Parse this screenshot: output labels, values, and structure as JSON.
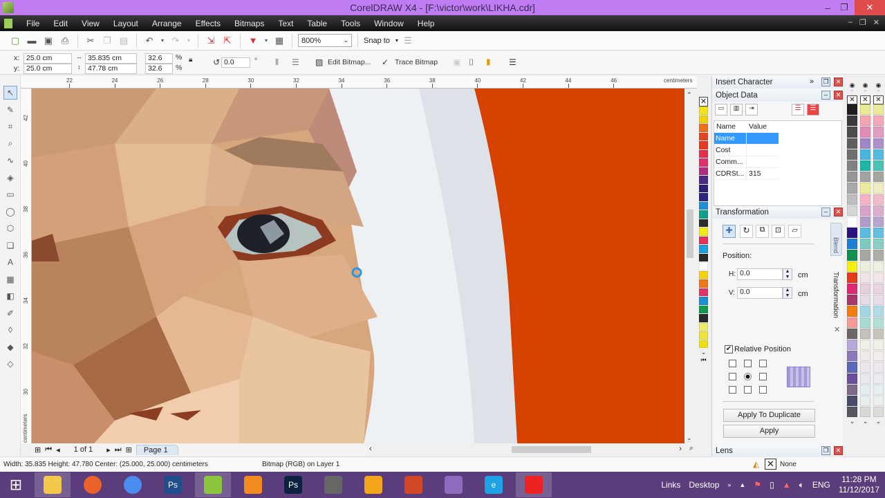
{
  "window": {
    "title": "CorelDRAW X4 - [F:\\victor\\work\\LIKHA.cdr]",
    "minimize": "–",
    "restore": "❐",
    "close": "✕"
  },
  "menu": {
    "items": [
      "File",
      "Edit",
      "View",
      "Layout",
      "Arrange",
      "Effects",
      "Bitmaps",
      "Text",
      "Table",
      "Tools",
      "Window",
      "Help"
    ],
    "mdi_controls": [
      "–",
      "❐",
      "✕"
    ]
  },
  "toolbar": {
    "zoom_level": "800%",
    "snap_to": "Snap to"
  },
  "property_bar": {
    "x_label": "x:",
    "x_value": "25.0 cm",
    "y_label": "y:",
    "y_value": "25.0 cm",
    "width_value": "35.835 cm",
    "height_value": "47.78 cm",
    "scale_x": "32.6",
    "scale_y": "32.6",
    "percent": "%",
    "rotation": "0.0",
    "degree": "°",
    "edit_bitmap": "Edit Bitmap...",
    "trace_bitmap": "Trace Bitmap"
  },
  "ruler": {
    "h_ticks": [
      "22",
      "24",
      "26",
      "28",
      "30",
      "32",
      "34",
      "36",
      "38",
      "40",
      "42",
      "44",
      "46"
    ],
    "h_unit": "centimeters",
    "v_ticks": [
      "42",
      "40",
      "38",
      "36",
      "34",
      "32",
      "30"
    ],
    "v_unit": "centimeters"
  },
  "tools": [
    {
      "name": "pick-tool",
      "glyph": "↖"
    },
    {
      "name": "shape-tool",
      "glyph": "✎"
    },
    {
      "name": "crop-tool",
      "glyph": "⌗"
    },
    {
      "name": "zoom-tool",
      "glyph": "⌕"
    },
    {
      "name": "freehand-tool",
      "glyph": "∿"
    },
    {
      "name": "smart-fill-tool",
      "glyph": "◈"
    },
    {
      "name": "rectangle-tool",
      "glyph": "▭"
    },
    {
      "name": "ellipse-tool",
      "glyph": "◯"
    },
    {
      "name": "polygon-tool",
      "glyph": "⬡"
    },
    {
      "name": "basic-shapes-tool",
      "glyph": "❏"
    },
    {
      "name": "text-tool",
      "glyph": "A"
    },
    {
      "name": "table-tool",
      "glyph": "▦"
    },
    {
      "name": "interactive-blend-tool",
      "glyph": "◧"
    },
    {
      "name": "eyedropper-tool",
      "glyph": "✐"
    },
    {
      "name": "outline-tool",
      "glyph": "◊"
    },
    {
      "name": "fill-tool",
      "glyph": "◆"
    },
    {
      "name": "interactive-fill-tool",
      "glyph": "◇"
    }
  ],
  "page_nav": {
    "counter": "1 of 1",
    "page_tab": "Page 1"
  },
  "status": {
    "dimensions": "Width: 35.835  Height: 47.780  Center: (25.000, 25.000)  centimeters",
    "object_info": "Bitmap (RGB) on Layer 1",
    "fill_none": "None"
  },
  "docker": {
    "insert_character": "Insert Character",
    "object_data": {
      "title": "Object Data",
      "columns": [
        "Name",
        "Value"
      ],
      "rows": [
        {
          "name": "Name",
          "value": ""
        },
        {
          "name": "Cost",
          "value": ""
        },
        {
          "name": "Comm...",
          "value": ""
        },
        {
          "name": "CDRSt...",
          "value": "315"
        }
      ]
    },
    "transformation": {
      "title": "Transformation",
      "position_label": "Position:",
      "h_label": "H:",
      "h_value": "0.0",
      "v_label": "V:",
      "v_value": "0.0",
      "unit": "cm",
      "relative_position": "Relative Position",
      "relative_checked": true,
      "apply_duplicate": "Apply To Duplicate",
      "apply": "Apply"
    },
    "side_tabs": [
      "Blend",
      "Transformation"
    ],
    "lens": "Lens"
  },
  "palette_main": [
    "#f3e21a",
    "#f0d20f",
    "#ef6f1a",
    "#e4461f",
    "#e63b23",
    "#e2304d",
    "#e0306e",
    "#b42b83",
    "#4b2a86",
    "#2e1f7a",
    "#2b2680",
    "#1d8fd6",
    "#11a088",
    "#2d2d2d",
    "#f2ea14",
    "#e4325c",
    "#1aa0dd",
    "#2a2a2a",
    "#ffffff",
    "#f5d20e",
    "#ef7918",
    "#e2336a",
    "#1c8fd4",
    "#129b4f",
    "#2a2a2a",
    "#eeea6a",
    "#eee33b",
    "#f0df12"
  ],
  "palette_gray": [
    "#1e1e1e",
    "#3a3a3a",
    "#4c4c4c",
    "#5e5e5e",
    "#6f6f6f",
    "#828282",
    "#959595",
    "#a9a9a9",
    "#bdbdbd",
    "#d6d6d6",
    "#ffffff",
    "#2c1280",
    "#1d7fd6",
    "#12924f",
    "#f5ee10",
    "#e33c16",
    "#e22872",
    "#a8386c",
    "#f07e12",
    "#f79a9a",
    "#6f6765",
    "#b7a9d8",
    "#8a78bb",
    "#5a6ab8",
    "#6b4f9e",
    "#7a6a8c",
    "#4a4d6a",
    "#565862"
  ],
  "palette_pastel1": [
    "#eaea94",
    "#f4a3b0",
    "#e08cb4",
    "#9e88c6",
    "#49b6df",
    "#1fb6a6",
    "#a3a3a3",
    "#ecec9e",
    "#f5b4c3",
    "#d7a3c8",
    "#b29ccc",
    "#5bbbe0",
    "#7ccac0",
    "#a8a8a0",
    "#eeeedf",
    "#f0e4e6",
    "#e6cfdc",
    "#e4dbe6",
    "#a6d6e6",
    "#a8dcd2",
    "#c4c0ba",
    "#f0efe4",
    "#f1eaea",
    "#ede6ec",
    "#e9e9ee",
    "#e4eef0",
    "#e7efee",
    "#d8d8d4"
  ],
  "palette_pastel2": [
    "#eaea9a",
    "#f6a8b6",
    "#e29dc0",
    "#ab93c9",
    "#54bbe0",
    "#4ac4b7",
    "#a7a7a0",
    "#eeeebe",
    "#f4bccb",
    "#dcb0cc",
    "#b9a6d0",
    "#64c0e2",
    "#88d0c6",
    "#aeaea6",
    "#efefe2",
    "#f2e7e9",
    "#e9d4e0",
    "#e7dee9",
    "#b1dbe8",
    "#b2e0d7",
    "#c8c4be",
    "#f1f0e6",
    "#f2ecec",
    "#eee8ee",
    "#ebebf0",
    "#e7eff1",
    "#e9f0ef",
    "#dcdcd8"
  ],
  "taskbar": {
    "apps": [
      {
        "name": "file-explorer",
        "color": "#f2c94c",
        "active": true
      },
      {
        "name": "firefox",
        "color": "#e8622a",
        "active": false
      },
      {
        "name": "chrome",
        "color": "#4a8cf0",
        "active": false
      },
      {
        "name": "photoshop-old",
        "color": "#1f4e8c",
        "active": false,
        "text": "Ps"
      },
      {
        "name": "coreldraw",
        "color": "#8cc63f",
        "active": true
      },
      {
        "name": "media-player",
        "color": "#f28b1f",
        "active": false
      },
      {
        "name": "photoshop-cc",
        "color": "#0b2340",
        "active": false,
        "text": "Ps"
      },
      {
        "name": "camera-app",
        "color": "#666",
        "active": false
      },
      {
        "name": "winamp",
        "color": "#f3a61b",
        "active": false
      },
      {
        "name": "powerpoint",
        "color": "#d24726",
        "active": false
      },
      {
        "name": "visual-studio",
        "color": "#8e6bbf",
        "active": false
      },
      {
        "name": "internet-explorer",
        "color": "#1fa2e6",
        "active": false,
        "text": "e"
      },
      {
        "name": "screen-recorder",
        "color": "#e22",
        "active": true
      }
    ],
    "links": "Links",
    "desktop": "Desktop",
    "lang": "ENG",
    "time": "11:28 PM",
    "date": "11/12/2017"
  }
}
